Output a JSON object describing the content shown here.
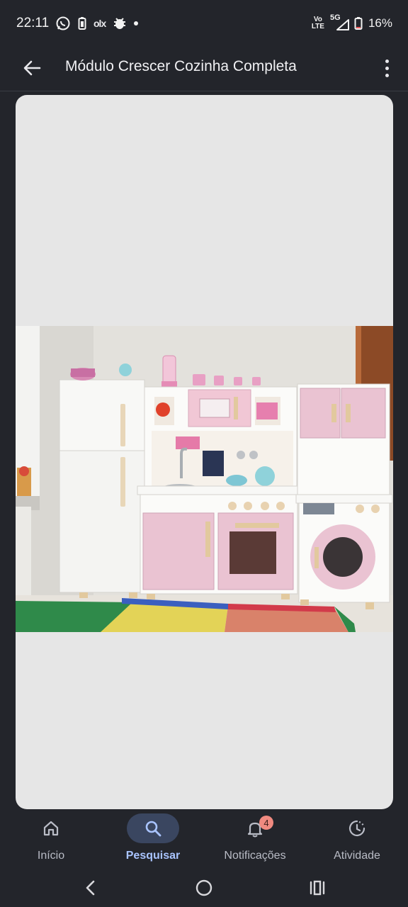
{
  "status_bar": {
    "time": "22:11",
    "left_icons": [
      "whatsapp-icon",
      "battery-saver-icon",
      "olx-icon",
      "bug-icon",
      "dot-icon"
    ],
    "olx_label": "olx",
    "volte_top": "Vo",
    "volte_bottom": "LTE",
    "network": "5G",
    "battery_percent": "16%"
  },
  "app_bar": {
    "title": "Módulo Crescer Cozinha Completa",
    "back_icon": "arrow-back-icon",
    "menu_icon": "more-vert-icon"
  },
  "photo": {
    "subject": "toy-kitchen-photo"
  },
  "bottom_nav": {
    "items": [
      {
        "label": "Início",
        "icon": "home-icon",
        "active": false
      },
      {
        "label": "Pesquisar",
        "icon": "search-icon",
        "active": true
      },
      {
        "label": "Notificações",
        "icon": "bell-icon",
        "active": false,
        "badge": "4"
      },
      {
        "label": "Atividade",
        "icon": "activity-icon",
        "active": false
      }
    ]
  },
  "system_nav": {
    "back_icon": "chevron-left-icon",
    "home_icon": "circle-home-icon",
    "recents_icon": "recents-icon"
  },
  "colors": {
    "background": "#23252b",
    "viewer_bg": "#e6e6e6",
    "active_nav": "#a9c4ff",
    "badge": "#f08a80"
  }
}
